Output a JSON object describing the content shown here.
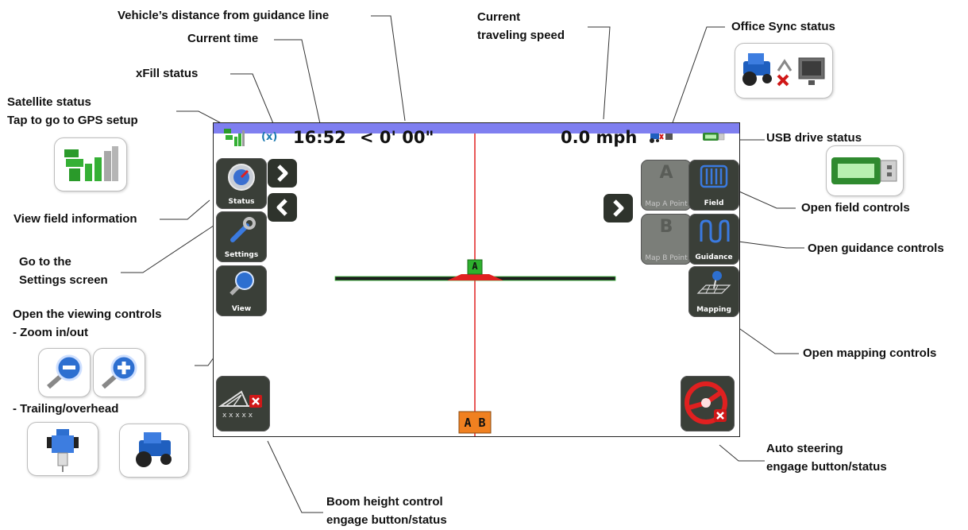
{
  "callouts": {
    "distance": "Vehicle’s distance from guidance line",
    "current_time": "Current time",
    "xfill": "xFill status",
    "satellite_1": "Satellite status",
    "satellite_2": "Tap to go to GPS setup",
    "speed_1": "Current",
    "speed_2": "traveling speed",
    "office_sync": "Office Sync status",
    "usb": "USB drive status",
    "field_info": "View field information",
    "settings_1": "Go to the",
    "settings_2": "Settings screen",
    "viewing_1": "Open the viewing controls",
    "viewing_2": "- Zoom in/out",
    "viewing_3": "- Trailing/overhead",
    "field_controls": "Open field controls",
    "guidance_controls": "Open guidance controls",
    "mapping_controls": "Open mapping controls",
    "autosteer_1": "Auto steering",
    "autosteer_2": "engage button/status",
    "boom_1": "Boom height control",
    "boom_2": "engage button/status"
  },
  "status_bar": {
    "time": "16:52",
    "distance": "< 0' 00\"",
    "speed": "0.0 mph",
    "xfill_glyph": "(x)"
  },
  "buttons": {
    "status": "Status",
    "settings": "Settings",
    "view": "View",
    "map_a_letter": "A",
    "map_a": "Map A Point",
    "map_b_letter": "B",
    "map_b": "Map B Point",
    "field": "Field",
    "guidance": "Guidance",
    "mapping": "Mapping"
  },
  "map": {
    "vehicle_marker": "A",
    "ab_marker": "A B"
  },
  "colors": {
    "status_bar": "#7f7ff0",
    "guidance_line": "#e02020",
    "tile": "#3a3f38",
    "tile_disabled": "#7b7e79",
    "ab_marker": "#f08020",
    "vehicle_marker": "#2db02d"
  }
}
